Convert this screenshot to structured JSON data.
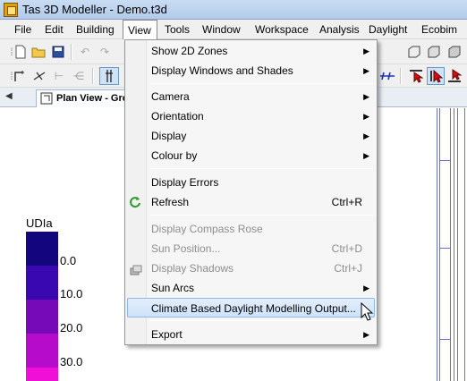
{
  "window": {
    "title": "Tas 3D Modeller - Demo.t3d"
  },
  "menubar": {
    "items": [
      {
        "label": "File"
      },
      {
        "label": "Edit"
      },
      {
        "label": "Building"
      },
      {
        "label": "View",
        "active": true
      },
      {
        "label": "Tools"
      },
      {
        "label": "Window"
      },
      {
        "label": "Workspace"
      },
      {
        "label": "Analysis"
      },
      {
        "label": "Daylight"
      },
      {
        "label": "Ecobim"
      }
    ]
  },
  "tabs": [
    {
      "label": "Plan View - Gro",
      "active": true
    }
  ],
  "view_menu": {
    "items": [
      {
        "label": "Show 2D Zones",
        "submenu": true
      },
      {
        "label": "Display Windows and Shades",
        "submenu": true
      },
      {
        "label": "Camera",
        "submenu": true
      },
      {
        "label": "Orientation",
        "submenu": true
      },
      {
        "label": "Display",
        "submenu": true
      },
      {
        "label": "Colour by",
        "submenu": true
      },
      {
        "label": "Display Errors"
      },
      {
        "label": "Refresh",
        "shortcut": "Ctrl+R",
        "icon": "refresh-icon"
      },
      {
        "label": "Display Compass Rose",
        "disabled": true
      },
      {
        "label": "Sun Position...",
        "shortcut": "Ctrl+D",
        "disabled": true
      },
      {
        "label": "Display Shadows",
        "shortcut": "Ctrl+J",
        "disabled": true,
        "icon": "shadows-icon"
      },
      {
        "label": "Sun Arcs",
        "submenu": true
      },
      {
        "label": "Climate Based Daylight Modelling Output...",
        "highlighted": true
      },
      {
        "label": "Export",
        "submenu": true
      }
    ]
  },
  "legend": {
    "title": "UDIa",
    "entries": [
      {
        "value": "0.0",
        "color": "#13057d"
      },
      {
        "value": "10.0",
        "color": "#3a08b0"
      },
      {
        "value": "20.0",
        "color": "#7609b8"
      },
      {
        "value": "30.0",
        "color": "#b70bcc"
      },
      {
        "value": "",
        "color": "#f00fd6"
      }
    ]
  },
  "colors": {
    "highlight": "#cde2f8",
    "disabled_text": "#8d8d8d",
    "structure_lines": "#6d6dd8"
  }
}
